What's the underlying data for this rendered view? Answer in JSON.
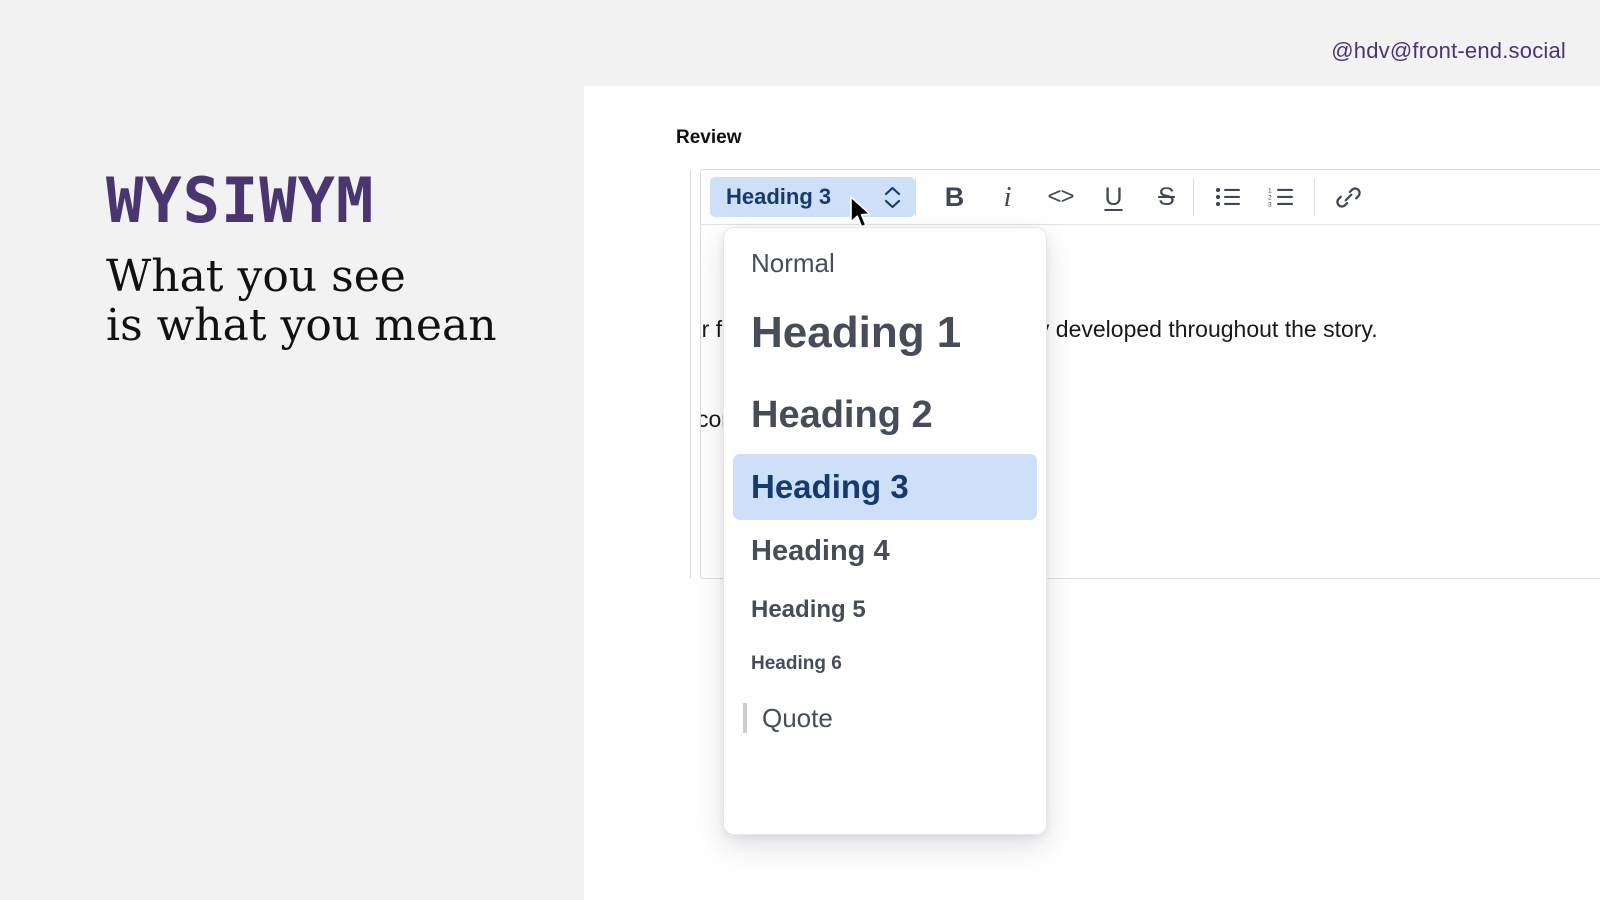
{
  "promo": {
    "title": "WYSIWYM",
    "tagline": "What you see\nis what you mean",
    "title_color": "#4b3570"
  },
  "handle": {
    "text": "@hdv@front-end.social",
    "color": "#4b3570"
  },
  "editor": {
    "field_label": "Review",
    "style_select": {
      "value": "Heading 3",
      "expanded": true,
      "background": "#cedff8",
      "text_color": "#143a6e"
    },
    "toolbar": [
      {
        "name": "bold",
        "label": "B",
        "glyph": "B"
      },
      {
        "name": "italic",
        "label": "i",
        "glyph": "i"
      },
      {
        "name": "code",
        "label": "Code",
        "glyph": "<>"
      },
      {
        "name": "underline",
        "label": "U",
        "glyph": "U"
      },
      {
        "name": "strikethrough",
        "label": "S",
        "glyph": "S"
      },
      {
        "name": "bulleted-list",
        "label": "Bulleted list",
        "glyph": ""
      },
      {
        "name": "numbered-list",
        "label": "Numbered list",
        "glyph": ""
      },
      {
        "name": "link",
        "label": "Link",
        "glyph": ""
      }
    ],
    "document_lines": [
      "Write about your favourite character and how they developed throughout the story.",
      "A few things to consider in your answers:"
    ]
  },
  "style_menu": {
    "items": [
      {
        "label": "Normal",
        "class": "mi-normal",
        "selected": false
      },
      {
        "label": "Heading 1",
        "class": "mi-h1",
        "selected": false
      },
      {
        "label": "Heading 2",
        "class": "mi-h2",
        "selected": false
      },
      {
        "label": "Heading 3",
        "class": "mi-h3",
        "selected": true
      },
      {
        "label": "Heading 4",
        "class": "mi-h4",
        "selected": false
      },
      {
        "label": "Heading 5",
        "class": "mi-h5",
        "selected": false
      },
      {
        "label": "Heading 6",
        "class": "mi-h6",
        "selected": false
      },
      {
        "label": "Quote",
        "class": "mi-quote",
        "selected": false
      }
    ],
    "selected_background": "#cedff8",
    "selected_text_color": "#143a6e"
  }
}
